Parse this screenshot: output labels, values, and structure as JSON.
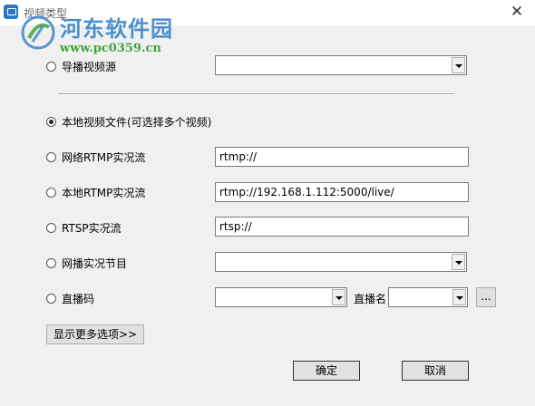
{
  "window": {
    "title": "视频类型",
    "close_glyph": "✕"
  },
  "watermark": {
    "name": "河东软件园",
    "url": "www.pc0359.cn"
  },
  "options": {
    "director": {
      "label": "导播视频源",
      "selected": false,
      "value": ""
    },
    "local_file": {
      "label": "本地视频文件(可选择多个视频)",
      "selected": true
    },
    "net_rtmp": {
      "label": "网络RTMP实况流",
      "selected": false,
      "value": "rtmp://"
    },
    "local_rtmp": {
      "label": "本地RTMP实况流",
      "selected": false,
      "value": "rtmp://192.168.1.112:5000/live/"
    },
    "rtsp": {
      "label": "RTSP实况流",
      "selected": false,
      "value": "rtsp://"
    },
    "net_program": {
      "label": "网播实况节目",
      "selected": false,
      "value": ""
    },
    "live_code": {
      "label": "直播码",
      "selected": false,
      "value": "",
      "name_label": "直播名",
      "name_value": "",
      "browse_label": "..."
    }
  },
  "buttons": {
    "more": "显示更多选项>>",
    "ok": "确定",
    "cancel": "取消"
  },
  "colors": {
    "logo_blue": "#3a86c9",
    "logo_green": "#43a33a"
  }
}
